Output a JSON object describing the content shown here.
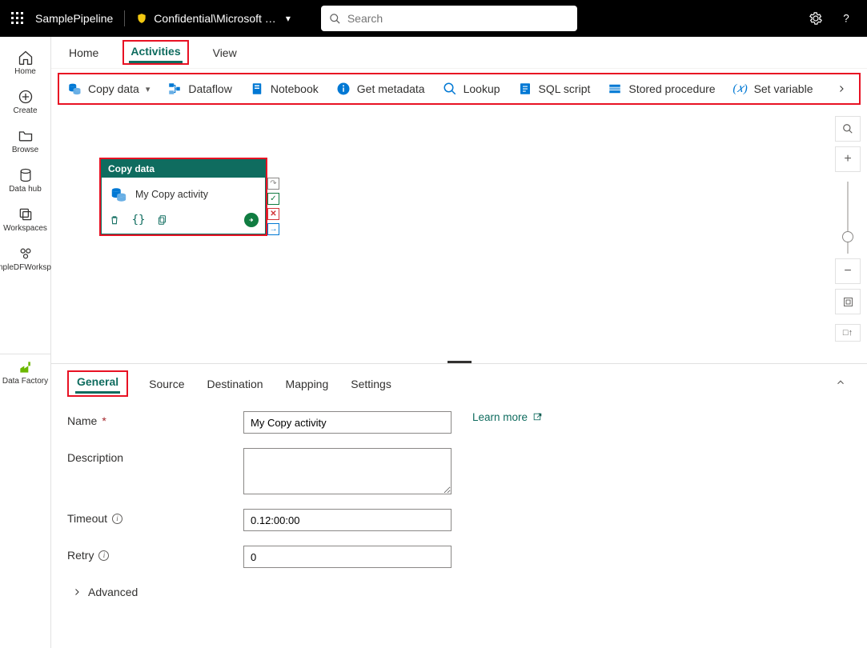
{
  "header": {
    "pipeline_name": "SamplePipeline",
    "breadcrumb": "Confidential\\Microsoft …",
    "search_placeholder": "Search"
  },
  "rail": {
    "items": [
      {
        "label": "Home"
      },
      {
        "label": "Create"
      },
      {
        "label": "Browse"
      },
      {
        "label": "Data hub"
      },
      {
        "label": "Workspaces"
      },
      {
        "label": "SampleDFWorkspace"
      }
    ],
    "bottom_label": "Data Factory"
  },
  "tabs": [
    {
      "label": "Home"
    },
    {
      "label": "Activities",
      "active": true
    },
    {
      "label": "View"
    }
  ],
  "activities_toolbar": [
    {
      "label": "Copy data",
      "has_dropdown": true
    },
    {
      "label": "Dataflow"
    },
    {
      "label": "Notebook"
    },
    {
      "label": "Get metadata"
    },
    {
      "label": "Lookup"
    },
    {
      "label": "SQL script"
    },
    {
      "label": "Stored procedure"
    },
    {
      "label": "Set variable"
    }
  ],
  "canvas": {
    "node": {
      "type_label": "Copy data",
      "activity_name": "My Copy activity"
    }
  },
  "properties": {
    "tabs": [
      {
        "label": "General",
        "active": true
      },
      {
        "label": "Source"
      },
      {
        "label": "Destination"
      },
      {
        "label": "Mapping"
      },
      {
        "label": "Settings"
      }
    ],
    "learn_more": "Learn more",
    "fields": {
      "name_label": "Name",
      "name_value": "My Copy activity",
      "description_label": "Description",
      "description_value": "",
      "timeout_label": "Timeout",
      "timeout_value": "0.12:00:00",
      "retry_label": "Retry",
      "retry_value": "0",
      "advanced_label": "Advanced"
    }
  }
}
